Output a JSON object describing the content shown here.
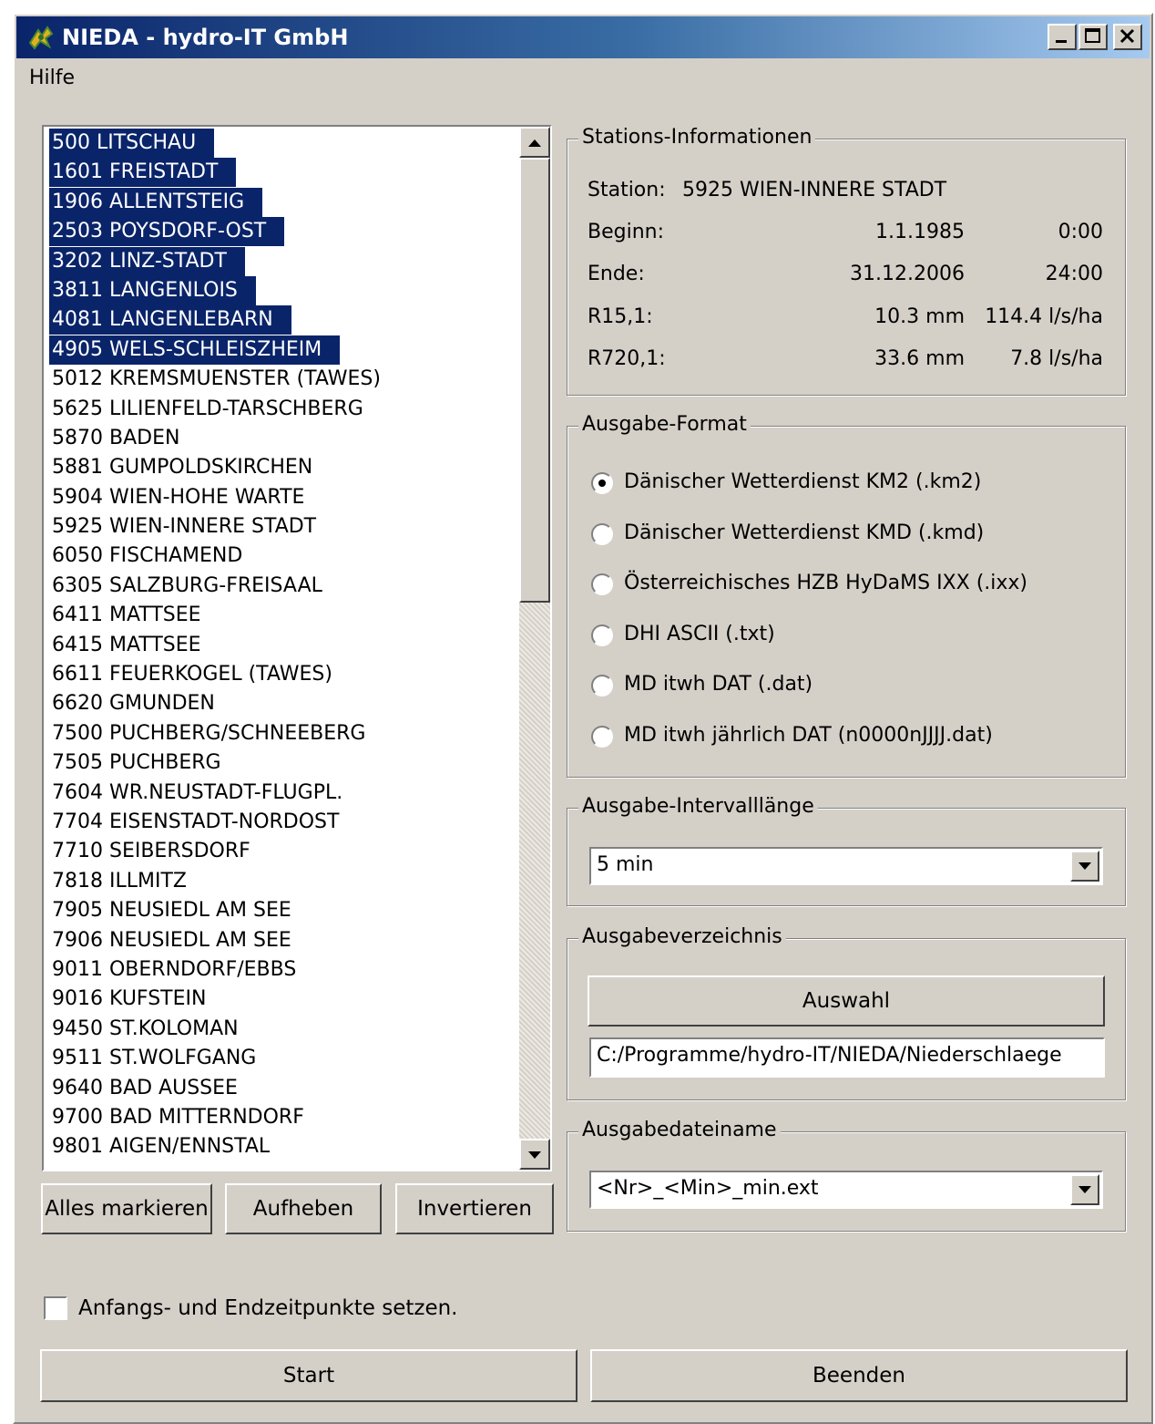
{
  "window": {
    "title": "NIEDA - hydro-IT GmbH"
  },
  "titlebar_buttons": {
    "minimize": "_",
    "maximize": "□",
    "close": "X"
  },
  "menu": {
    "items": [
      "Hilfe"
    ]
  },
  "station_list": {
    "items": [
      {
        "label": "500 LITSCHAU",
        "selected": true
      },
      {
        "label": "1601 FREISTADT",
        "selected": true
      },
      {
        "label": "1906 ALLENTSTEIG",
        "selected": true
      },
      {
        "label": "2503 POYSDORF-OST",
        "selected": true
      },
      {
        "label": "3202 LINZ-STADT",
        "selected": true
      },
      {
        "label": "3811 LANGENLOIS",
        "selected": true
      },
      {
        "label": "4081 LANGENLEBARN",
        "selected": true
      },
      {
        "label": "4905 WELS-SCHLEISZHEIM",
        "selected": true
      },
      {
        "label": "5012 KREMSMUENSTER (TAWES)",
        "selected": false
      },
      {
        "label": "5625 LILIENFELD-TARSCHBERG",
        "selected": false
      },
      {
        "label": "5870 BADEN",
        "selected": false
      },
      {
        "label": "5881 GUMPOLDSKIRCHEN",
        "selected": false
      },
      {
        "label": "5904 WIEN-HOHE WARTE",
        "selected": false
      },
      {
        "label": "5925 WIEN-INNERE STADT",
        "selected": false
      },
      {
        "label": "6050 FISCHAMEND",
        "selected": false
      },
      {
        "label": "6305 SALZBURG-FREISAAL",
        "selected": false
      },
      {
        "label": "6411 MATTSEE",
        "selected": false
      },
      {
        "label": "6415 MATTSEE",
        "selected": false
      },
      {
        "label": "6611 FEUERKOGEL (TAWES)",
        "selected": false
      },
      {
        "label": "6620 GMUNDEN",
        "selected": false
      },
      {
        "label": "7500 PUCHBERG/SCHNEEBERG",
        "selected": false
      },
      {
        "label": "7505 PUCHBERG",
        "selected": false
      },
      {
        "label": "7604 WR.NEUSTADT-FLUGPL.",
        "selected": false
      },
      {
        "label": "7704 EISENSTADT-NORDOST",
        "selected": false
      },
      {
        "label": "7710 SEIBERSDORF",
        "selected": false
      },
      {
        "label": "7818 ILLMITZ",
        "selected": false
      },
      {
        "label": "7905 NEUSIEDL AM SEE",
        "selected": false
      },
      {
        "label": "7906 NEUSIEDL AM SEE",
        "selected": false
      },
      {
        "label": "9011 OBERNDORF/EBBS",
        "selected": false
      },
      {
        "label": "9016 KUFSTEIN",
        "selected": false
      },
      {
        "label": "9450 ST.KOLOMAN",
        "selected": false
      },
      {
        "label": "9511 ST.WOLFGANG",
        "selected": false
      },
      {
        "label": "9640 BAD AUSSEE",
        "selected": false
      },
      {
        "label": "9700 BAD MITTERNDORF",
        "selected": false
      },
      {
        "label": "9801 AIGEN/ENNSTAL",
        "selected": false
      }
    ]
  },
  "list_buttons": {
    "select_all": "Alles markieren",
    "deselect": "Aufheben",
    "invert": "Invertieren"
  },
  "station_info": {
    "legend": "Stations-Informationen",
    "station_label": "Station:",
    "station_value": "5925 WIEN-INNERE STADT",
    "begin_label": "Beginn:",
    "begin_date": "1.1.1985",
    "begin_time": "0:00",
    "end_label": "Ende:",
    "end_date": "31.12.2006",
    "end_time": "24:00",
    "r15_label": "R15,1:",
    "r15_mm": "10.3 mm",
    "r15_rate": "114.4 l/s/ha",
    "r720_label": "R720,1:",
    "r720_mm": "33.6 mm",
    "r720_rate": "7.8 l/s/ha"
  },
  "output_format": {
    "legend": "Ausgabe-Format",
    "options": [
      {
        "label": "Dänischer Wetterdienst KM2 (.km2)",
        "checked": true
      },
      {
        "label": "Dänischer Wetterdienst KMD (.kmd)",
        "checked": false
      },
      {
        "label": "Österreichisches HZB HyDaMS IXX (.ixx)",
        "checked": false
      },
      {
        "label": "DHI ASCII (.txt)",
        "checked": false
      },
      {
        "label": "MD itwh DAT (.dat)",
        "checked": false
      },
      {
        "label": "MD itwh jährlich DAT (n0000nJJJJ.dat)",
        "checked": false
      }
    ]
  },
  "interval": {
    "legend": "Ausgabe-Intervalllänge",
    "value": "5 min"
  },
  "output_dir": {
    "legend": "Ausgabeverzeichnis",
    "button": "Auswahl",
    "path": "C:/Programme/hydro-IT/NIEDA/Niederschlaege"
  },
  "output_filename": {
    "legend": "Ausgabedateiname",
    "value": "<Nr>_<Min>_min.ext"
  },
  "time_checkbox": {
    "label": "Anfangs- und Endzeitpunkte setzen.",
    "checked": false
  },
  "footer": {
    "start": "Start",
    "quit": "Beenden"
  }
}
